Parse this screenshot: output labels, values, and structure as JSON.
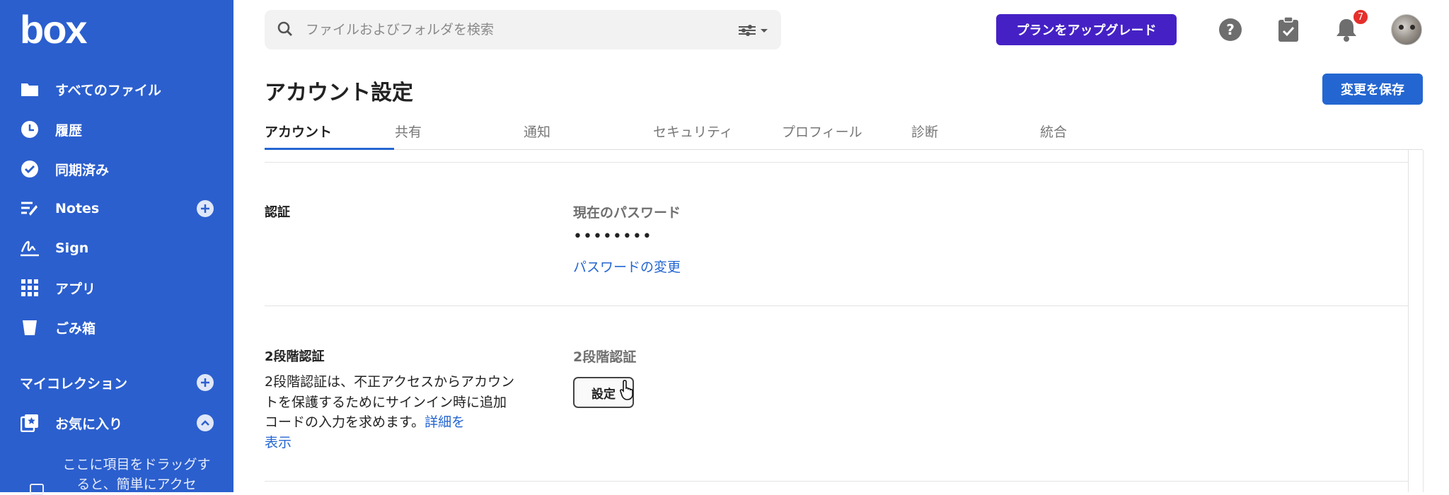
{
  "app": {
    "logo": "box"
  },
  "sidebar": {
    "items": [
      {
        "label": "すべてのファイル",
        "icon": "folder-icon"
      },
      {
        "label": "履歴",
        "icon": "clock-icon"
      },
      {
        "label": "同期済み",
        "icon": "check-circle-icon"
      },
      {
        "label": "Notes",
        "icon": "notes-icon"
      },
      {
        "label": "Sign",
        "icon": "sign-icon"
      },
      {
        "label": "アプリ",
        "icon": "apps-grid-icon"
      },
      {
        "label": "ごみ箱",
        "icon": "trash-icon"
      }
    ],
    "collections_label": "マイコレクション",
    "favorites_label": "お気に入り",
    "drag_hint": "ここに項目をドラッグすると、簡単にアクセ"
  },
  "header": {
    "search_placeholder": "ファイルおよびフォルダを検索",
    "upgrade_label": "プランをアップグレード",
    "notification_count": "7"
  },
  "page": {
    "title": "アカウント設定",
    "save_label": "変更を保存",
    "tabs": [
      {
        "label": "アカウント",
        "active": true
      },
      {
        "label": "共有"
      },
      {
        "label": "通知"
      },
      {
        "label": "セキュリティ"
      },
      {
        "label": "プロフィール"
      },
      {
        "label": "診断"
      },
      {
        "label": "統合"
      }
    ]
  },
  "auth": {
    "title": "認証",
    "current_password_label": "現在のパスワード",
    "password_mask": "••••••••",
    "change_password_link": "パスワードの変更"
  },
  "two_factor": {
    "title": "2段階認証",
    "description": "2段階認証は、不正アクセスからアカウントを保護するためにサインイン時に追加コードの入力を求めます。",
    "details_link_a": "詳細を",
    "details_link_b": "表示",
    "field_label": "2段階認証",
    "setup_label": "設定"
  },
  "colors": {
    "sidebar": "#2b5fce",
    "upgrade": "#4521c5",
    "primary": "#2466d1",
    "badge": "#e5302c"
  }
}
